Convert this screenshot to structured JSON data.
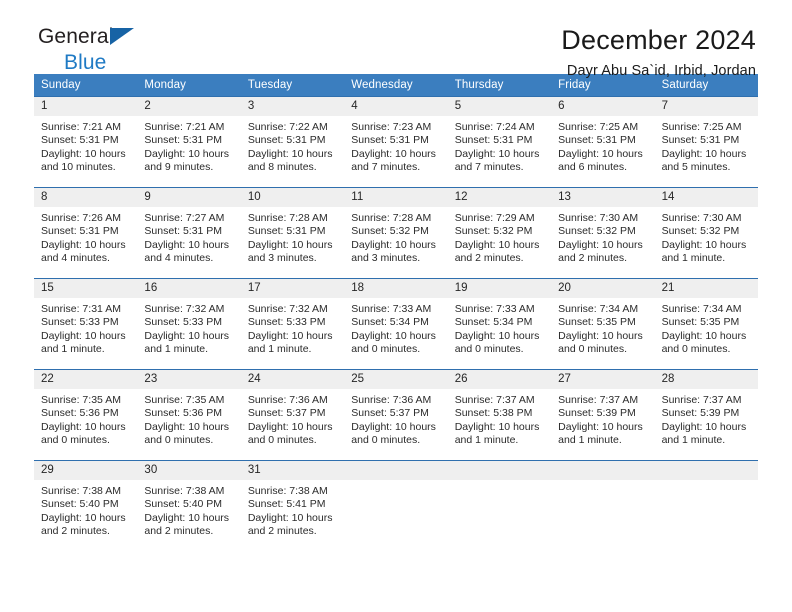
{
  "brand": {
    "name_part1": "General",
    "name_part2": "Blue",
    "accent_color": "#1f7ac4"
  },
  "header": {
    "title": "December 2024",
    "subtitle": "Dayr Abu Sa`id, Irbid, Jordan"
  },
  "calendar": {
    "header_color": "#3b7ebf",
    "day_names": [
      "Sunday",
      "Monday",
      "Tuesday",
      "Wednesday",
      "Thursday",
      "Friday",
      "Saturday"
    ],
    "weeks": [
      [
        {
          "date": "1",
          "lines": [
            "Sunrise: 7:21 AM",
            "Sunset: 5:31 PM",
            "Daylight: 10 hours",
            "and 10 minutes."
          ]
        },
        {
          "date": "2",
          "lines": [
            "Sunrise: 7:21 AM",
            "Sunset: 5:31 PM",
            "Daylight: 10 hours",
            "and 9 minutes."
          ]
        },
        {
          "date": "3",
          "lines": [
            "Sunrise: 7:22 AM",
            "Sunset: 5:31 PM",
            "Daylight: 10 hours",
            "and 8 minutes."
          ]
        },
        {
          "date": "4",
          "lines": [
            "Sunrise: 7:23 AM",
            "Sunset: 5:31 PM",
            "Daylight: 10 hours",
            "and 7 minutes."
          ]
        },
        {
          "date": "5",
          "lines": [
            "Sunrise: 7:24 AM",
            "Sunset: 5:31 PM",
            "Daylight: 10 hours",
            "and 7 minutes."
          ]
        },
        {
          "date": "6",
          "lines": [
            "Sunrise: 7:25 AM",
            "Sunset: 5:31 PM",
            "Daylight: 10 hours",
            "and 6 minutes."
          ]
        },
        {
          "date": "7",
          "lines": [
            "Sunrise: 7:25 AM",
            "Sunset: 5:31 PM",
            "Daylight: 10 hours",
            "and 5 minutes."
          ]
        }
      ],
      [
        {
          "date": "8",
          "lines": [
            "Sunrise: 7:26 AM",
            "Sunset: 5:31 PM",
            "Daylight: 10 hours",
            "and 4 minutes."
          ]
        },
        {
          "date": "9",
          "lines": [
            "Sunrise: 7:27 AM",
            "Sunset: 5:31 PM",
            "Daylight: 10 hours",
            "and 4 minutes."
          ]
        },
        {
          "date": "10",
          "lines": [
            "Sunrise: 7:28 AM",
            "Sunset: 5:31 PM",
            "Daylight: 10 hours",
            "and 3 minutes."
          ]
        },
        {
          "date": "11",
          "lines": [
            "Sunrise: 7:28 AM",
            "Sunset: 5:32 PM",
            "Daylight: 10 hours",
            "and 3 minutes."
          ]
        },
        {
          "date": "12",
          "lines": [
            "Sunrise: 7:29 AM",
            "Sunset: 5:32 PM",
            "Daylight: 10 hours",
            "and 2 minutes."
          ]
        },
        {
          "date": "13",
          "lines": [
            "Sunrise: 7:30 AM",
            "Sunset: 5:32 PM",
            "Daylight: 10 hours",
            "and 2 minutes."
          ]
        },
        {
          "date": "14",
          "lines": [
            "Sunrise: 7:30 AM",
            "Sunset: 5:32 PM",
            "Daylight: 10 hours",
            "and 1 minute."
          ]
        }
      ],
      [
        {
          "date": "15",
          "lines": [
            "Sunrise: 7:31 AM",
            "Sunset: 5:33 PM",
            "Daylight: 10 hours",
            "and 1 minute."
          ]
        },
        {
          "date": "16",
          "lines": [
            "Sunrise: 7:32 AM",
            "Sunset: 5:33 PM",
            "Daylight: 10 hours",
            "and 1 minute."
          ]
        },
        {
          "date": "17",
          "lines": [
            "Sunrise: 7:32 AM",
            "Sunset: 5:33 PM",
            "Daylight: 10 hours",
            "and 1 minute."
          ]
        },
        {
          "date": "18",
          "lines": [
            "Sunrise: 7:33 AM",
            "Sunset: 5:34 PM",
            "Daylight: 10 hours",
            "and 0 minutes."
          ]
        },
        {
          "date": "19",
          "lines": [
            "Sunrise: 7:33 AM",
            "Sunset: 5:34 PM",
            "Daylight: 10 hours",
            "and 0 minutes."
          ]
        },
        {
          "date": "20",
          "lines": [
            "Sunrise: 7:34 AM",
            "Sunset: 5:35 PM",
            "Daylight: 10 hours",
            "and 0 minutes."
          ]
        },
        {
          "date": "21",
          "lines": [
            "Sunrise: 7:34 AM",
            "Sunset: 5:35 PM",
            "Daylight: 10 hours",
            "and 0 minutes."
          ]
        }
      ],
      [
        {
          "date": "22",
          "lines": [
            "Sunrise: 7:35 AM",
            "Sunset: 5:36 PM",
            "Daylight: 10 hours",
            "and 0 minutes."
          ]
        },
        {
          "date": "23",
          "lines": [
            "Sunrise: 7:35 AM",
            "Sunset: 5:36 PM",
            "Daylight: 10 hours",
            "and 0 minutes."
          ]
        },
        {
          "date": "24",
          "lines": [
            "Sunrise: 7:36 AM",
            "Sunset: 5:37 PM",
            "Daylight: 10 hours",
            "and 0 minutes."
          ]
        },
        {
          "date": "25",
          "lines": [
            "Sunrise: 7:36 AM",
            "Sunset: 5:37 PM",
            "Daylight: 10 hours",
            "and 0 minutes."
          ]
        },
        {
          "date": "26",
          "lines": [
            "Sunrise: 7:37 AM",
            "Sunset: 5:38 PM",
            "Daylight: 10 hours",
            "and 1 minute."
          ]
        },
        {
          "date": "27",
          "lines": [
            "Sunrise: 7:37 AM",
            "Sunset: 5:39 PM",
            "Daylight: 10 hours",
            "and 1 minute."
          ]
        },
        {
          "date": "28",
          "lines": [
            "Sunrise: 7:37 AM",
            "Sunset: 5:39 PM",
            "Daylight: 10 hours",
            "and 1 minute."
          ]
        }
      ],
      [
        {
          "date": "29",
          "lines": [
            "Sunrise: 7:38 AM",
            "Sunset: 5:40 PM",
            "Daylight: 10 hours",
            "and 2 minutes."
          ]
        },
        {
          "date": "30",
          "lines": [
            "Sunrise: 7:38 AM",
            "Sunset: 5:40 PM",
            "Daylight: 10 hours",
            "and 2 minutes."
          ]
        },
        {
          "date": "31",
          "lines": [
            "Sunrise: 7:38 AM",
            "Sunset: 5:41 PM",
            "Daylight: 10 hours",
            "and 2 minutes."
          ]
        },
        {
          "date": "",
          "lines": []
        },
        {
          "date": "",
          "lines": []
        },
        {
          "date": "",
          "lines": []
        },
        {
          "date": "",
          "lines": []
        }
      ]
    ]
  }
}
